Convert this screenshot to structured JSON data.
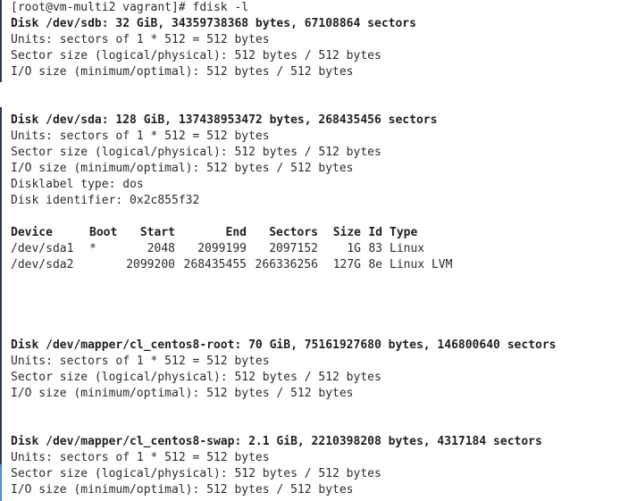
{
  "terminal": {
    "prompt_line": "[root@vm-multi2 vagrant]# fdisk -l",
    "disks": [
      {
        "header": "Disk /dev/sdb: 32 GiB, 34359738368 bytes, 67108864 sectors",
        "lines": [
          "Units: sectors of 1 * 512 = 512 bytes",
          "Sector size (logical/physical): 512 bytes / 512 bytes",
          "I/O size (minimum/optimal): 512 bytes / 512 bytes"
        ]
      },
      {
        "header": "Disk /dev/sda: 128 GiB, 137438953472 bytes, 268435456 sectors",
        "lines": [
          "Units: sectors of 1 * 512 = 512 bytes",
          "Sector size (logical/physical): 512 bytes / 512 bytes",
          "I/O size (minimum/optimal): 512 bytes / 512 bytes",
          "Disklabel type: dos",
          "Disk identifier: 0x2c855f32"
        ]
      },
      {
        "header": "Disk /dev/mapper/cl_centos8-root: 70 GiB, 75161927680 bytes, 146800640 sectors",
        "lines": [
          "Units: sectors of 1 * 512 = 512 bytes",
          "Sector size (logical/physical): 512 bytes / 512 bytes",
          "I/O size (minimum/optimal): 512 bytes / 512 bytes"
        ]
      },
      {
        "header": "Disk /dev/mapper/cl_centos8-swap: 2.1 GiB, 2210398208 bytes, 4317184 sectors",
        "lines": [
          "Units: sectors of 1 * 512 = 512 bytes",
          "Sector size (logical/physical): 512 bytes / 512 bytes",
          "I/O size (minimum/optimal): 512 bytes / 512 bytes"
        ]
      }
    ],
    "partition_table": {
      "headers": [
        "Device",
        "Boot",
        "Start",
        "End",
        "Sectors",
        "Size",
        "Id",
        "Type"
      ],
      "rows": [
        [
          "/dev/sda1",
          "*",
          "2048",
          "2099199",
          "2097152",
          "1G",
          "83",
          "Linux"
        ],
        [
          "/dev/sda2",
          "",
          "2099200",
          "268435455",
          "266336256",
          "127G",
          "8e",
          "Linux LVM"
        ]
      ]
    }
  }
}
